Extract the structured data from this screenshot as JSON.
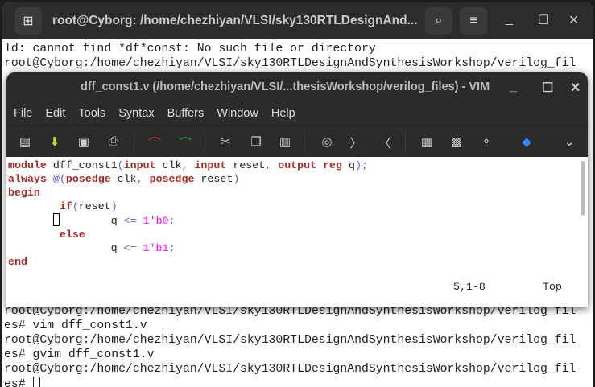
{
  "terminal": {
    "title": "root@Cyborg: /home/chezhiyan/VLSI/sky130RTLDesignAnd...",
    "lines_top": [
      "ld: cannot find *df*const: No such file or directory",
      "root@Cyborg:/home/chezhiyan/VLSI/sky130RTLDesignAndSynthesisWorkshop/verilog_fil"
    ],
    "lines_bottom": [
      "root@Cyborg:/home/chezhiyan/VLSI/sky130RTLDesignAndSynthesisWorkshop/verilog_fil",
      "es# vim dff_const1.v",
      "root@Cyborg:/home/chezhiyan/VLSI/sky130RTLDesignAndSynthesisWorkshop/verilog_fil",
      "es# gvim dff_const1.v",
      "root@Cyborg:/home/chezhiyan/VLSI/sky130RTLDesignAndSynthesisWorkshop/verilog_fil",
      "es# "
    ]
  },
  "vim": {
    "title": "dff_const1.v (/home/chezhiyan/VLSI/...thesisWorkshop/verilog_files) - VIM",
    "menu": [
      "File",
      "Edit",
      "Tools",
      "Syntax",
      "Buffers",
      "Window",
      "Help"
    ],
    "code": {
      "l1": [
        "module",
        " dff_const1",
        "(",
        "input",
        " clk",
        ",",
        " input",
        " reset",
        ",",
        " output",
        " reg",
        " q",
        ");"
      ],
      "l2": [
        "always",
        " @(",
        "posedge",
        " clk",
        ",",
        " posedge",
        " reset",
        ")"
      ],
      "l3": "begin",
      "l4": [
        "if",
        "(",
        "reset",
        ")"
      ],
      "l5": [
        "q",
        " <=",
        " 1'b0",
        ";"
      ],
      "l6": "else",
      "l7": [
        "q",
        " <=",
        " 1'b1",
        ";"
      ],
      "l8": "end"
    },
    "position": "5,1-8",
    "scroll": "Top"
  },
  "colors": {
    "keyword": "#a52a2a",
    "constant": "#ff00ff",
    "paren": "#6a5acd"
  }
}
